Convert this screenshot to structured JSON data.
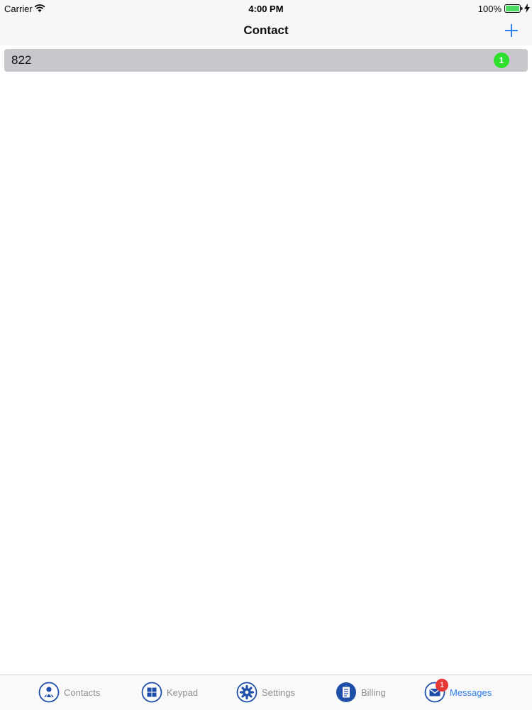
{
  "status_bar": {
    "carrier": "Carrier",
    "wifi_icon": "wifi-icon",
    "time": "4:00 PM",
    "battery_percent": "100%",
    "battery_icon": "battery-icon",
    "charge_icon": "charging-bolt-icon"
  },
  "nav": {
    "title": "Contact",
    "add_icon": "plus-icon"
  },
  "contacts": [
    {
      "name": "822",
      "unread": "1"
    }
  ],
  "tabs": [
    {
      "label": "Contacts",
      "icon": "contacts-icon",
      "active": false
    },
    {
      "label": "Keypad",
      "icon": "keypad-icon",
      "active": false
    },
    {
      "label": "Settings",
      "icon": "settings-gear-icon",
      "active": false
    },
    {
      "label": "Billing",
      "icon": "billing-document-icon",
      "active": false
    },
    {
      "label": "Messages",
      "icon": "messages-envelope-icon",
      "active": true,
      "badge": "1"
    }
  ],
  "colors": {
    "accent": "#2f80ed",
    "icon_blue": "#1f4fa8",
    "row_bg": "#c8c7cc",
    "unread_badge": "#2de02d",
    "tab_badge": "#e53935"
  }
}
